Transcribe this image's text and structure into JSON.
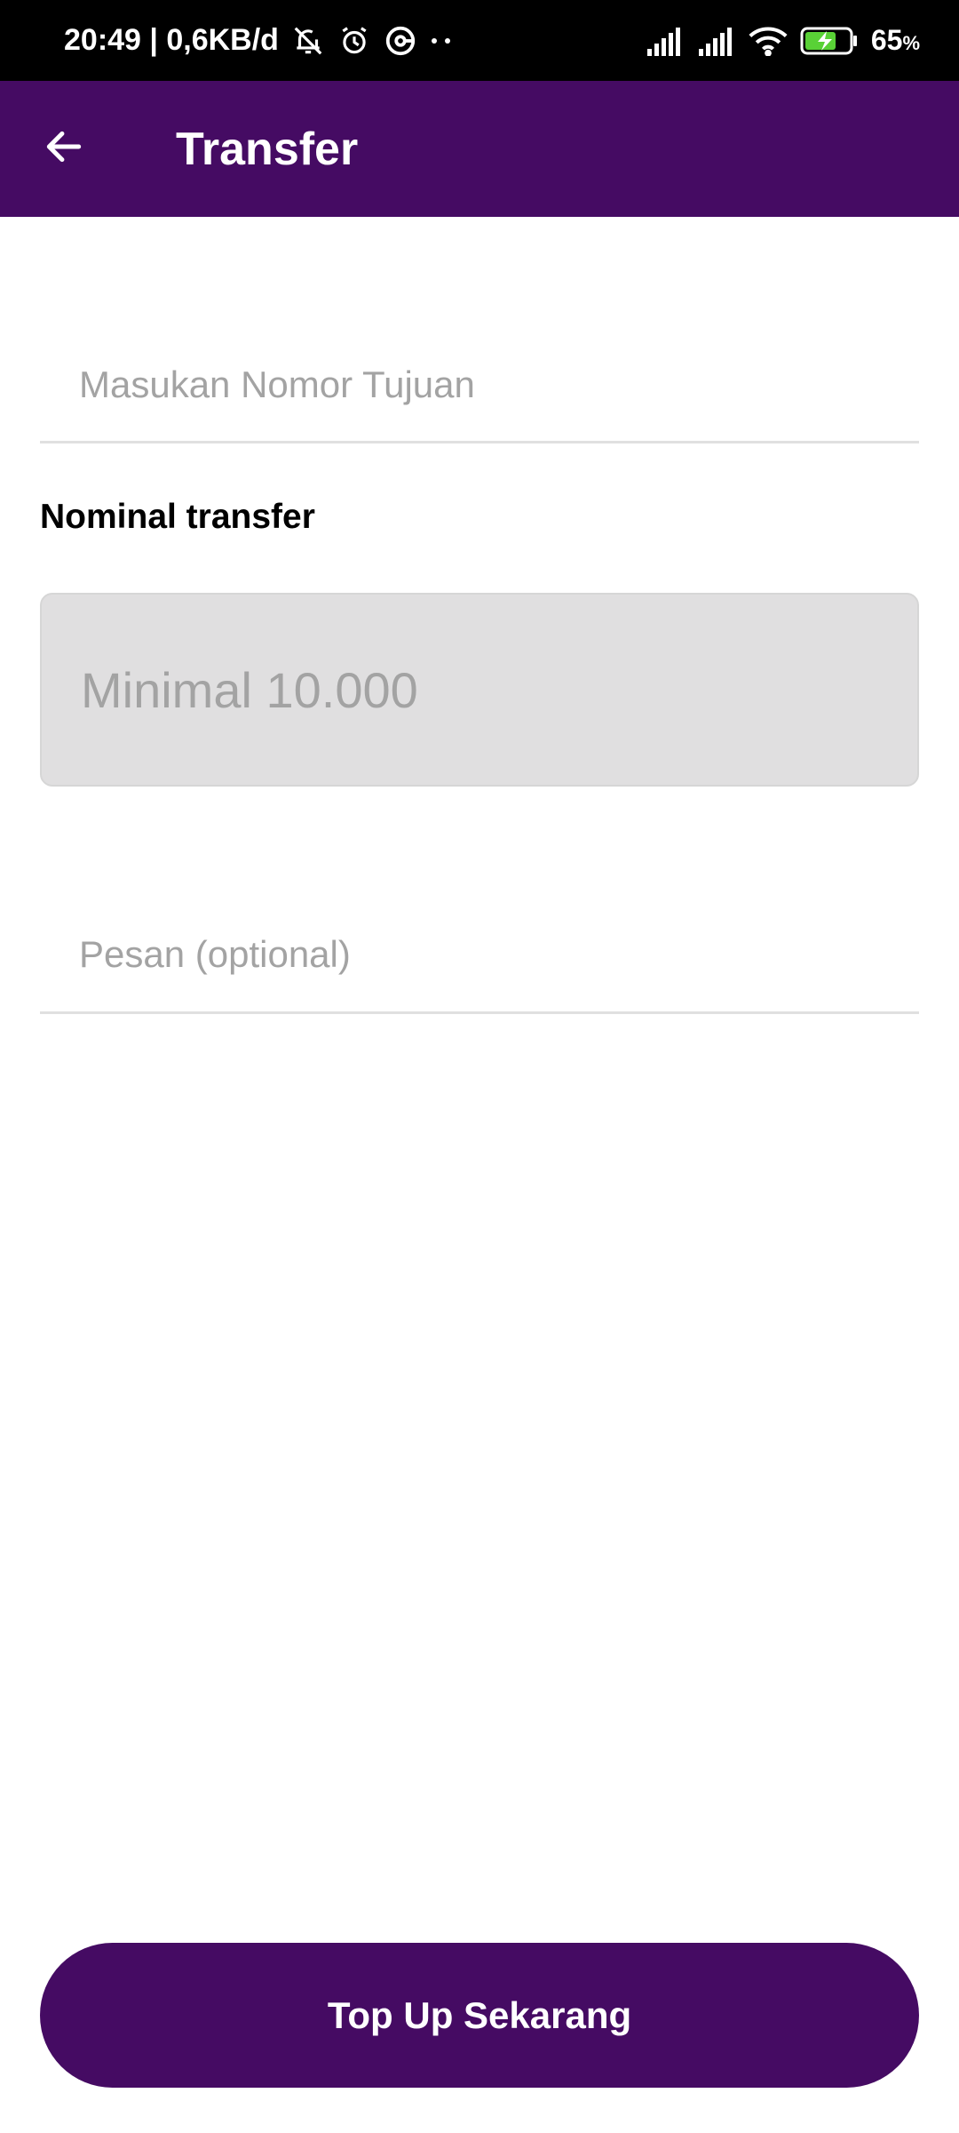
{
  "status_bar": {
    "time_info": "20:49 | 0,6KB/d",
    "battery_percent": "65",
    "battery_unit": "%",
    "icons": [
      "mute-bell-icon",
      "alarm-icon",
      "vpn-icon",
      "more-dots-icon",
      "signal-icon",
      "signal-icon",
      "wifi-icon",
      "battery-charging-icon"
    ]
  },
  "app_bar": {
    "title": "Transfer",
    "back_icon": "arrow-left-icon"
  },
  "form": {
    "destination_placeholder": "Masukan Nomor Tujuan",
    "nominal_label": "Nominal transfer",
    "nominal_placeholder": "Minimal 10.000",
    "message_placeholder": "Pesan (optional)"
  },
  "actions": {
    "topup_label": "Top Up Sekarang"
  },
  "colors": {
    "brand": "#450b63",
    "statusbar": "#000000",
    "nominal_bg": "#e0dfe0"
  }
}
